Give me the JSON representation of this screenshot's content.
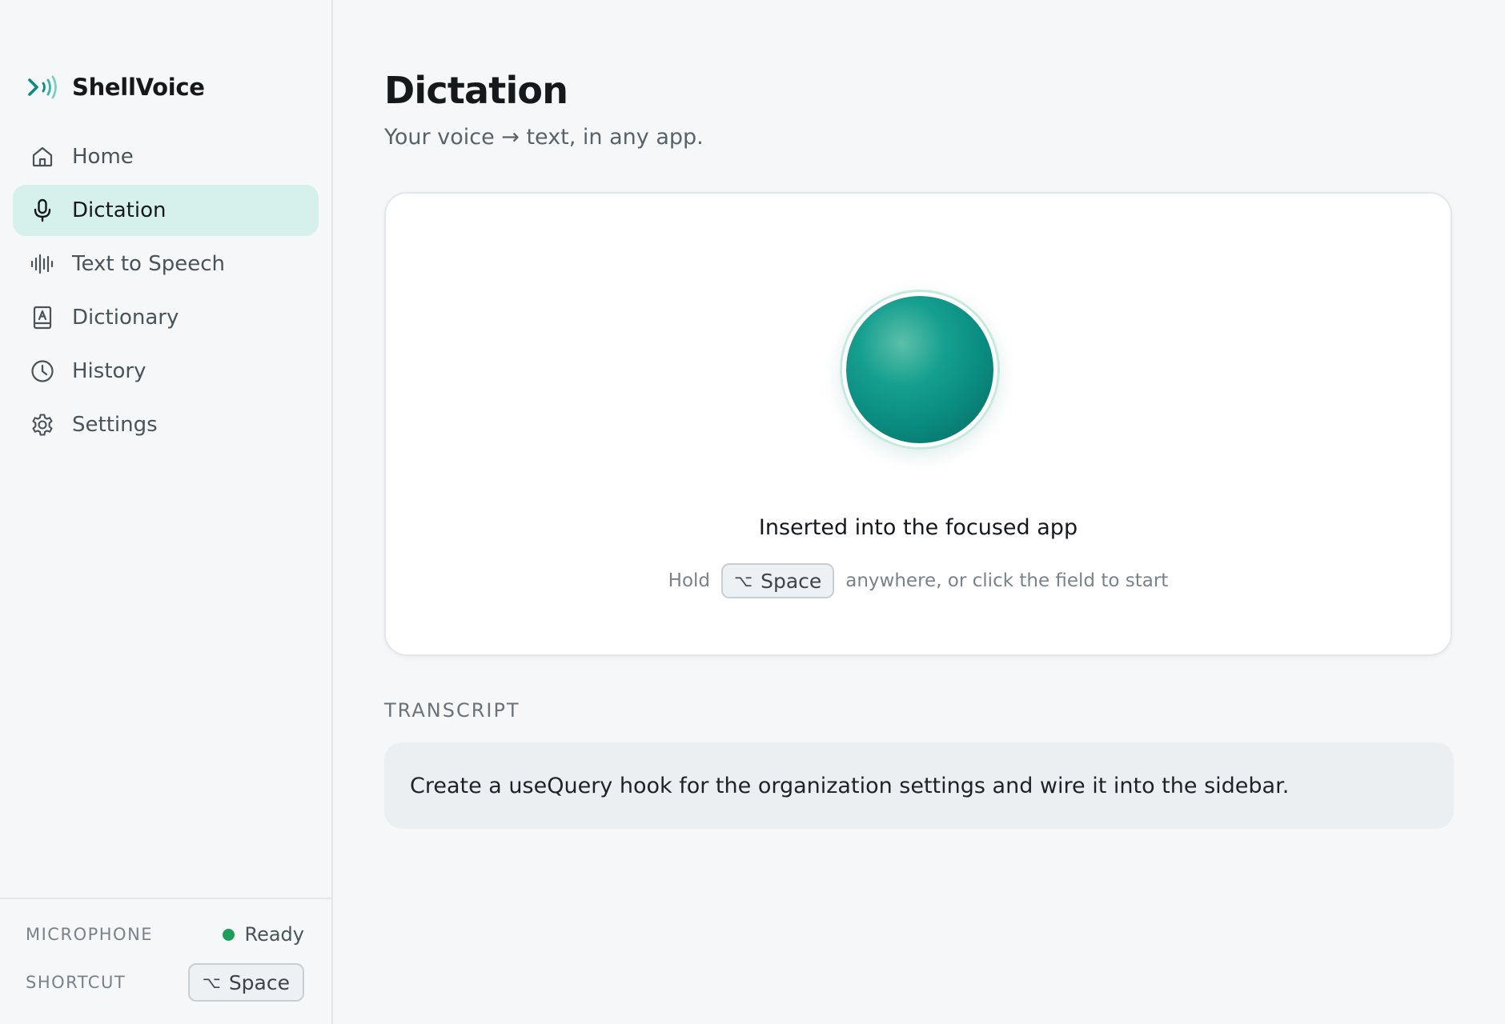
{
  "app": {
    "name": "ShellVoice"
  },
  "nav": {
    "items": [
      {
        "id": "home",
        "label": "Home",
        "icon": "home-icon",
        "active": false
      },
      {
        "id": "dictation",
        "label": "Dictation",
        "icon": "microphone-icon",
        "active": true
      },
      {
        "id": "tts",
        "label": "Text to Speech",
        "icon": "waveform-icon",
        "active": false
      },
      {
        "id": "dictionary",
        "label": "Dictionary",
        "icon": "book-icon",
        "active": false
      },
      {
        "id": "history",
        "label": "History",
        "icon": "clock-icon",
        "active": false
      },
      {
        "id": "settings",
        "label": "Settings",
        "icon": "gear-icon",
        "active": false
      }
    ]
  },
  "footer": {
    "microphone_label": "MICROPHONE",
    "microphone_status": "Ready",
    "shortcut_label": "SHORTCUT",
    "shortcut_mod": "⌥",
    "shortcut_key": "Space"
  },
  "page": {
    "title": "Dictation",
    "subtitle": "Your voice → text, in any app."
  },
  "card": {
    "status": "Inserted into the focused app",
    "hint_prefix": "Hold",
    "hint_mod": "⌥",
    "hint_key": "Space",
    "hint_suffix": "anywhere, or click the field to start"
  },
  "transcript": {
    "label": "TRANSCRIPT",
    "text": "Create a useQuery hook for the organization settings and wire it into the sidebar."
  },
  "colors": {
    "accent": "#0a8c80",
    "active_nav_bg": "#d6f1ec",
    "status_ready": "#1f9d5c"
  }
}
